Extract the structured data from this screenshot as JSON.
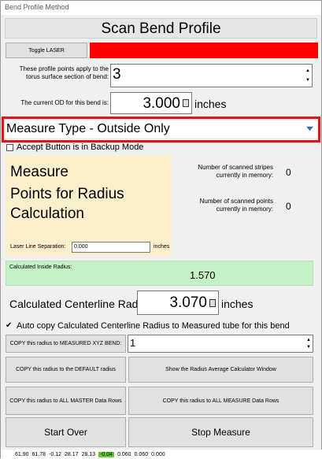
{
  "window": {
    "title": "Bend Profile Method"
  },
  "header": {
    "title": "Scan Bend Profile"
  },
  "laser": {
    "toggle_label": "Toggle LASER",
    "status_color": "#ff0000"
  },
  "profile_points": {
    "label_line1": "These profile points apply to the",
    "label_line2": "torus surface section of bend:",
    "value": "3"
  },
  "od": {
    "label": "The current OD for this bend is:",
    "value": "3.000",
    "unit": "inches",
    "icon": "calculator-icon"
  },
  "measure_type": {
    "selected": "Measure Type - Outside Only",
    "icon": "dropdown-arrow-icon"
  },
  "accept_backup": {
    "label": "Accept Button is in Backup Mode",
    "checked": false
  },
  "measure_panel": {
    "line1": "Measure",
    "line2": "Points for Radius",
    "line3": "Calculation",
    "laser_sep_label": "Laser Line Separation:",
    "laser_sep_value": "0.000",
    "laser_sep_unit": "inches",
    "bg_color": "#fdeecc"
  },
  "stats": {
    "stripes_label_1": "Number of scanned stripes",
    "stripes_label_2": "currently in memory:",
    "stripes_value": "0",
    "points_label_1": "Number of scanned points",
    "points_label_2": "currently in memory:",
    "points_value": "0"
  },
  "inside_radius": {
    "label": "Calculated Inside Radius:",
    "value": "1.570",
    "bg_color": "#c6f0c6"
  },
  "centerline": {
    "label": "Calculated Centerline Radius",
    "value": "3.070",
    "unit": "inches"
  },
  "auto_copy": {
    "label": "Auto copy Calculated Centerline Radius to Measured tube for this bend",
    "checked": true
  },
  "copy_xyz": {
    "label": "COPY this radius to MEASURED XYZ BEND:",
    "value": "1"
  },
  "buttons": {
    "copy_default": "COPY this radius to the DEFAULT radius",
    "show_avg": "Show the Radius Average Calculator Window",
    "copy_master": "COPY this radius to ALL MASTER Data Rows",
    "copy_measure": "COPY this radius to ALL MEASURE Data Rows",
    "start_over": "Start Over",
    "stop_measure": "Stop Measure"
  },
  "status_values": [
    "61.90",
    "61.78",
    "-0.12",
    "28.17",
    "28.13",
    "-0.04",
    "0.060",
    "0.060",
    "0.000"
  ]
}
